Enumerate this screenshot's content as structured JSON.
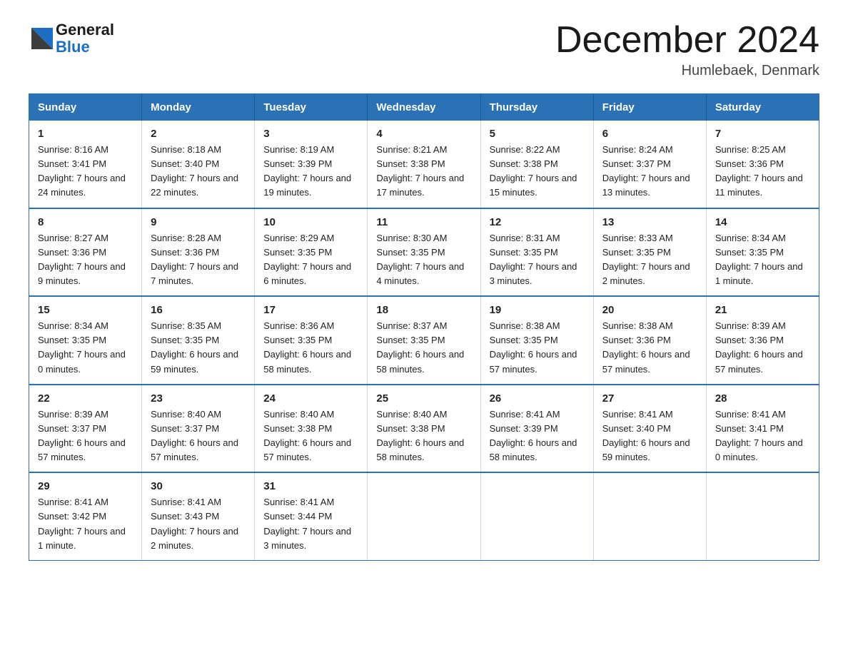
{
  "header": {
    "logo_general": "General",
    "logo_blue": "Blue",
    "month_title": "December 2024",
    "location": "Humlebaek, Denmark"
  },
  "weekdays": [
    "Sunday",
    "Monday",
    "Tuesday",
    "Wednesday",
    "Thursday",
    "Friday",
    "Saturday"
  ],
  "weeks": [
    [
      {
        "day": "1",
        "sunrise": "Sunrise: 8:16 AM",
        "sunset": "Sunset: 3:41 PM",
        "daylight": "Daylight: 7 hours and 24 minutes."
      },
      {
        "day": "2",
        "sunrise": "Sunrise: 8:18 AM",
        "sunset": "Sunset: 3:40 PM",
        "daylight": "Daylight: 7 hours and 22 minutes."
      },
      {
        "day": "3",
        "sunrise": "Sunrise: 8:19 AM",
        "sunset": "Sunset: 3:39 PM",
        "daylight": "Daylight: 7 hours and 19 minutes."
      },
      {
        "day": "4",
        "sunrise": "Sunrise: 8:21 AM",
        "sunset": "Sunset: 3:38 PM",
        "daylight": "Daylight: 7 hours and 17 minutes."
      },
      {
        "day": "5",
        "sunrise": "Sunrise: 8:22 AM",
        "sunset": "Sunset: 3:38 PM",
        "daylight": "Daylight: 7 hours and 15 minutes."
      },
      {
        "day": "6",
        "sunrise": "Sunrise: 8:24 AM",
        "sunset": "Sunset: 3:37 PM",
        "daylight": "Daylight: 7 hours and 13 minutes."
      },
      {
        "day": "7",
        "sunrise": "Sunrise: 8:25 AM",
        "sunset": "Sunset: 3:36 PM",
        "daylight": "Daylight: 7 hours and 11 minutes."
      }
    ],
    [
      {
        "day": "8",
        "sunrise": "Sunrise: 8:27 AM",
        "sunset": "Sunset: 3:36 PM",
        "daylight": "Daylight: 7 hours and 9 minutes."
      },
      {
        "day": "9",
        "sunrise": "Sunrise: 8:28 AM",
        "sunset": "Sunset: 3:36 PM",
        "daylight": "Daylight: 7 hours and 7 minutes."
      },
      {
        "day": "10",
        "sunrise": "Sunrise: 8:29 AM",
        "sunset": "Sunset: 3:35 PM",
        "daylight": "Daylight: 7 hours and 6 minutes."
      },
      {
        "day": "11",
        "sunrise": "Sunrise: 8:30 AM",
        "sunset": "Sunset: 3:35 PM",
        "daylight": "Daylight: 7 hours and 4 minutes."
      },
      {
        "day": "12",
        "sunrise": "Sunrise: 8:31 AM",
        "sunset": "Sunset: 3:35 PM",
        "daylight": "Daylight: 7 hours and 3 minutes."
      },
      {
        "day": "13",
        "sunrise": "Sunrise: 8:33 AM",
        "sunset": "Sunset: 3:35 PM",
        "daylight": "Daylight: 7 hours and 2 minutes."
      },
      {
        "day": "14",
        "sunrise": "Sunrise: 8:34 AM",
        "sunset": "Sunset: 3:35 PM",
        "daylight": "Daylight: 7 hours and 1 minute."
      }
    ],
    [
      {
        "day": "15",
        "sunrise": "Sunrise: 8:34 AM",
        "sunset": "Sunset: 3:35 PM",
        "daylight": "Daylight: 7 hours and 0 minutes."
      },
      {
        "day": "16",
        "sunrise": "Sunrise: 8:35 AM",
        "sunset": "Sunset: 3:35 PM",
        "daylight": "Daylight: 6 hours and 59 minutes."
      },
      {
        "day": "17",
        "sunrise": "Sunrise: 8:36 AM",
        "sunset": "Sunset: 3:35 PM",
        "daylight": "Daylight: 6 hours and 58 minutes."
      },
      {
        "day": "18",
        "sunrise": "Sunrise: 8:37 AM",
        "sunset": "Sunset: 3:35 PM",
        "daylight": "Daylight: 6 hours and 58 minutes."
      },
      {
        "day": "19",
        "sunrise": "Sunrise: 8:38 AM",
        "sunset": "Sunset: 3:35 PM",
        "daylight": "Daylight: 6 hours and 57 minutes."
      },
      {
        "day": "20",
        "sunrise": "Sunrise: 8:38 AM",
        "sunset": "Sunset: 3:36 PM",
        "daylight": "Daylight: 6 hours and 57 minutes."
      },
      {
        "day": "21",
        "sunrise": "Sunrise: 8:39 AM",
        "sunset": "Sunset: 3:36 PM",
        "daylight": "Daylight: 6 hours and 57 minutes."
      }
    ],
    [
      {
        "day": "22",
        "sunrise": "Sunrise: 8:39 AM",
        "sunset": "Sunset: 3:37 PM",
        "daylight": "Daylight: 6 hours and 57 minutes."
      },
      {
        "day": "23",
        "sunrise": "Sunrise: 8:40 AM",
        "sunset": "Sunset: 3:37 PM",
        "daylight": "Daylight: 6 hours and 57 minutes."
      },
      {
        "day": "24",
        "sunrise": "Sunrise: 8:40 AM",
        "sunset": "Sunset: 3:38 PM",
        "daylight": "Daylight: 6 hours and 57 minutes."
      },
      {
        "day": "25",
        "sunrise": "Sunrise: 8:40 AM",
        "sunset": "Sunset: 3:38 PM",
        "daylight": "Daylight: 6 hours and 58 minutes."
      },
      {
        "day": "26",
        "sunrise": "Sunrise: 8:41 AM",
        "sunset": "Sunset: 3:39 PM",
        "daylight": "Daylight: 6 hours and 58 minutes."
      },
      {
        "day": "27",
        "sunrise": "Sunrise: 8:41 AM",
        "sunset": "Sunset: 3:40 PM",
        "daylight": "Daylight: 6 hours and 59 minutes."
      },
      {
        "day": "28",
        "sunrise": "Sunrise: 8:41 AM",
        "sunset": "Sunset: 3:41 PM",
        "daylight": "Daylight: 7 hours and 0 minutes."
      }
    ],
    [
      {
        "day": "29",
        "sunrise": "Sunrise: 8:41 AM",
        "sunset": "Sunset: 3:42 PM",
        "daylight": "Daylight: 7 hours and 1 minute."
      },
      {
        "day": "30",
        "sunrise": "Sunrise: 8:41 AM",
        "sunset": "Sunset: 3:43 PM",
        "daylight": "Daylight: 7 hours and 2 minutes."
      },
      {
        "day": "31",
        "sunrise": "Sunrise: 8:41 AM",
        "sunset": "Sunset: 3:44 PM",
        "daylight": "Daylight: 7 hours and 3 minutes."
      },
      null,
      null,
      null,
      null
    ]
  ]
}
